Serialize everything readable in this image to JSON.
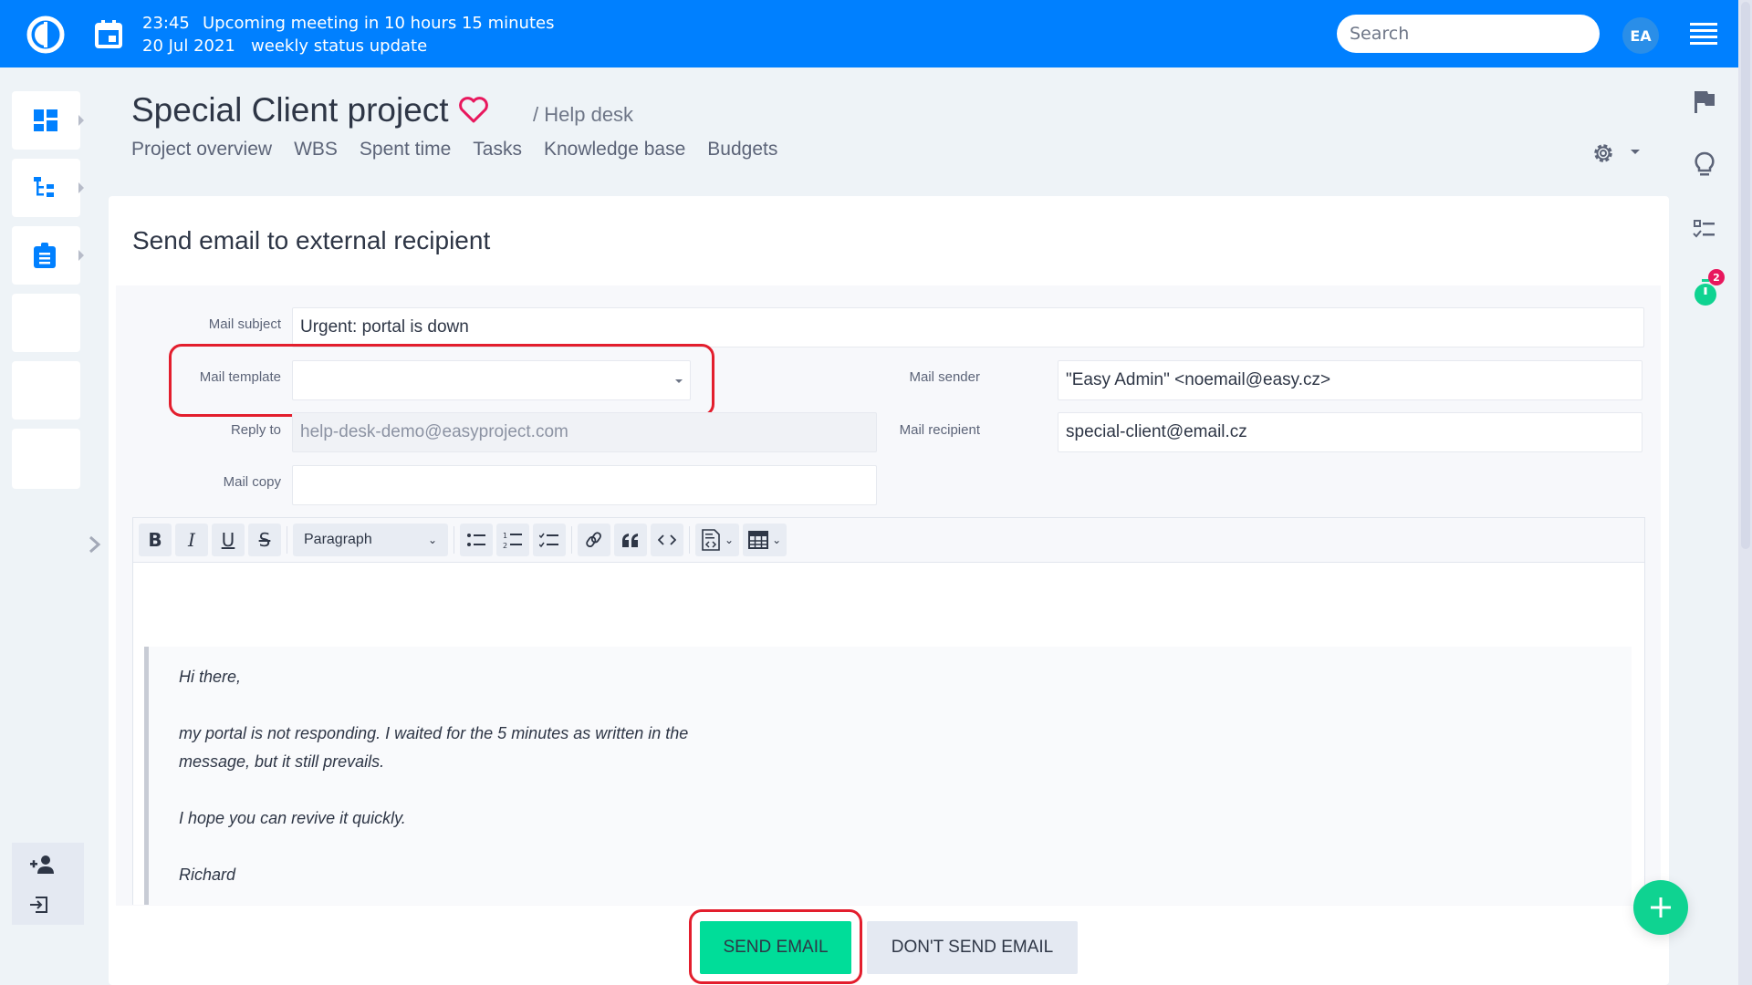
{
  "topbar": {
    "meeting_time": "23:45",
    "meeting_text": "Upcoming meeting in 10 hours 15 minutes",
    "meeting_date": "20 Jul 2021",
    "meeting_name": "weekly status update",
    "search_placeholder": "Search",
    "avatar_initials": "EA",
    "brand_color": "#0080ff"
  },
  "left_sidebar": {
    "items": [
      {
        "icon": "dashboard-icon"
      },
      {
        "icon": "wbs-tree-icon"
      },
      {
        "icon": "clipboard-icon"
      },
      {
        "icon": ""
      },
      {
        "icon": ""
      },
      {
        "icon": ""
      }
    ],
    "bottom": [
      {
        "icon": "add-user-icon"
      },
      {
        "icon": "login-icon"
      }
    ]
  },
  "project": {
    "title": "Special Client project",
    "breadcrumb": "/ Help desk",
    "tabs": [
      "Project overview",
      "WBS",
      "Spent time",
      "Tasks",
      "Knowledge base",
      "Budgets"
    ]
  },
  "right_sidebar": {
    "items": [
      "flag-icon",
      "lightbulb-icon",
      "checklist-icon",
      "timer-icon"
    ],
    "timer_badge": "2"
  },
  "form": {
    "title": "Send email to external recipient",
    "fields": {
      "mail_subject": {
        "label": "Mail subject",
        "value": "Urgent: portal is down"
      },
      "mail_template": {
        "label": "Mail template",
        "value": ""
      },
      "reply_to": {
        "label": "Reply to",
        "value": "help-desk-demo@easyproject.com"
      },
      "mail_copy": {
        "label": "Mail copy",
        "value": ""
      },
      "mail_sender": {
        "label": "Mail sender",
        "value": "\"Easy Admin\" <noemail@easy.cz>"
      },
      "mail_recipient": {
        "label": "Mail recipient",
        "value": "special-client@email.cz"
      }
    },
    "editor": {
      "paragraph_style": "Paragraph",
      "toolbar": [
        "bold",
        "italic",
        "underline",
        "strikethrough",
        "paragraph",
        "bulleted-list",
        "numbered-list",
        "todo-list",
        "link",
        "blockquote",
        "code",
        "source",
        "table"
      ],
      "quote_lines": [
        "Hi there,",
        "my portal is not responding. I waited for the 5 minutes as written in the",
        "message, but it still prevails.",
        "I hope you can revive it quickly.",
        "Richard"
      ]
    },
    "send_label": "SEND EMAIL",
    "dont_send_label": "DON'T SEND EMAIL",
    "send_color": "#00dd99",
    "highlight_color": "#e31e2d"
  }
}
